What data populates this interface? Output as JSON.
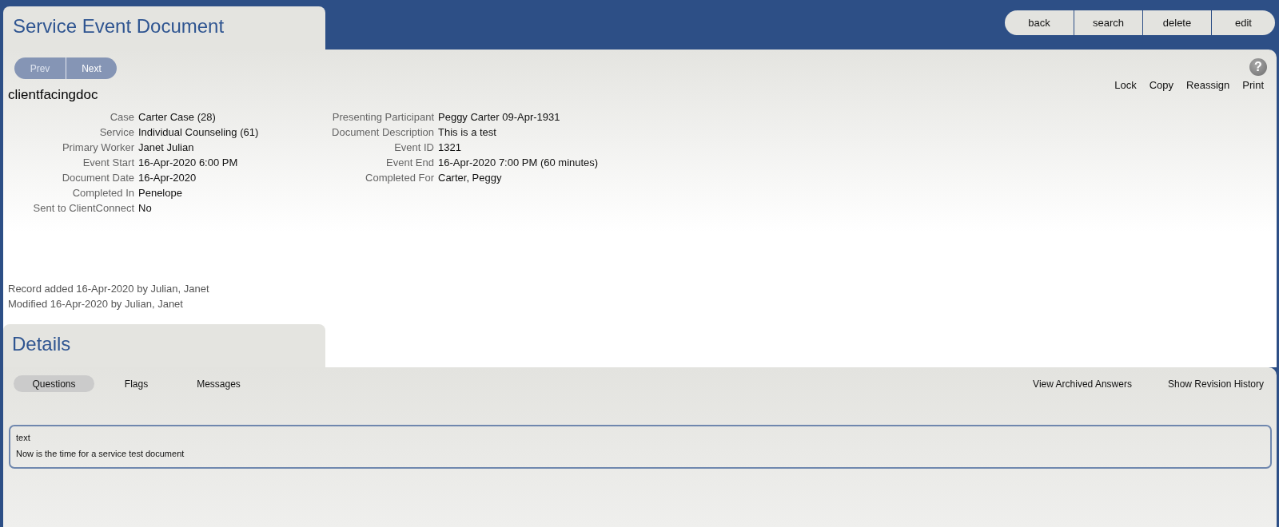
{
  "header": {
    "title": "Service Event Document",
    "actions": [
      "back",
      "search",
      "delete",
      "edit"
    ]
  },
  "pager": [
    {
      "label": "Prev",
      "disabled": true
    },
    {
      "label": "Next",
      "disabled": false
    }
  ],
  "help": {
    "glyph": "?"
  },
  "record_actions": [
    "Lock",
    "Copy",
    "Reassign",
    "Print"
  ],
  "document": {
    "name": "clientfacingdoc",
    "columns": [
      [
        {
          "label": "Case",
          "value": "Carter Case (28)"
        },
        {
          "label": "Service",
          "value": "Individual Counseling (61)"
        },
        {
          "label": "Primary Worker",
          "value": "Janet Julian"
        },
        {
          "label": "Event Start",
          "value": "16-Apr-2020 6:00 PM"
        },
        {
          "label": "Document Date",
          "value": "16-Apr-2020"
        },
        {
          "label": "Completed In",
          "value": "Penelope"
        },
        {
          "label": "Sent to ClientConnect",
          "value": "No"
        }
      ],
      [
        {
          "label": "Presenting Participant",
          "value": "Peggy Carter 09-Apr-1931"
        },
        {
          "label": "Document Description",
          "value": "This is a test"
        },
        {
          "label": "Event ID",
          "value": "1321"
        },
        {
          "label": "Event End",
          "value": "16-Apr-2020 7:00 PM (60 minutes)"
        },
        {
          "label": "Completed For",
          "value": "Carter, Peggy"
        }
      ]
    ]
  },
  "audit": [
    "Record added 16-Apr-2020 by Julian, Janet",
    "Modified 16-Apr-2020 by Julian, Janet"
  ],
  "details": {
    "title": "Details",
    "tabs": [
      {
        "label": "Questions",
        "selected": true
      },
      {
        "label": "Flags",
        "selected": false
      },
      {
        "label": "Messages",
        "selected": false
      }
    ],
    "links": [
      "View Archived Answers",
      "Show Revision History"
    ],
    "questions": [
      {
        "label": "text",
        "answer": "Now is the time for a service test document"
      }
    ]
  }
}
